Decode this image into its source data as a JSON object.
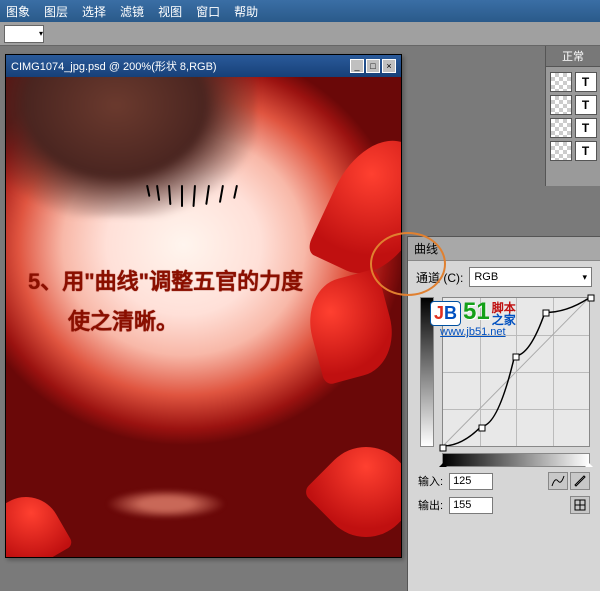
{
  "menu": {
    "items": [
      "图象",
      "图层",
      "选择",
      "滤镜",
      "视图",
      "窗口",
      "帮助"
    ]
  },
  "doc": {
    "title": "CIMG1074_jpg.psd @ 200%(形状 8,RGB)",
    "caption_line1": "5、用\"曲线\"调整五官的力度",
    "caption_line2": "使之清晰。"
  },
  "right_rail": {
    "tab": "正常"
  },
  "curves": {
    "title": "曲线",
    "channel_label": "通道 (C):",
    "channel_value": "RGB",
    "input_label": "输入:",
    "input_value": "125",
    "output_label": "输出:",
    "output_value": "155",
    "points": [
      {
        "x": 0,
        "y": 0
      },
      {
        "x": 67,
        "y": 34
      },
      {
        "x": 125,
        "y": 155
      },
      {
        "x": 178,
        "y": 230
      },
      {
        "x": 255,
        "y": 255
      }
    ]
  },
  "watermark": {
    "brand_cn1": "脚本",
    "brand_cn2": "之家",
    "url": "www.jb51.net"
  },
  "chart_data": {
    "type": "line",
    "title": "曲线",
    "xlabel": "输入",
    "ylabel": "输出",
    "xlim": [
      0,
      255
    ],
    "ylim": [
      0,
      255
    ],
    "series": [
      {
        "name": "RGB",
        "x": [
          0,
          67,
          125,
          178,
          255
        ],
        "y": [
          0,
          34,
          155,
          230,
          255
        ]
      }
    ]
  }
}
